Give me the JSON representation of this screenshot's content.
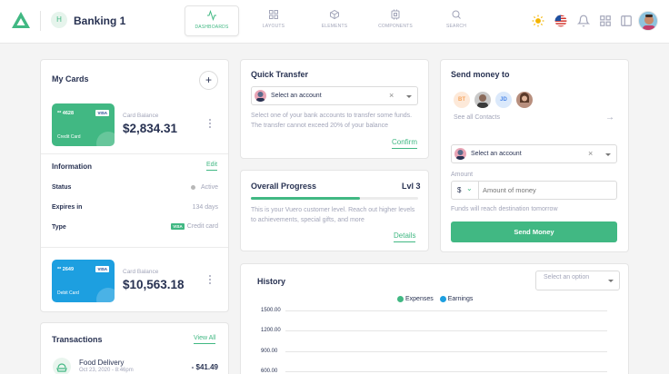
{
  "header": {
    "workspace_initial": "H",
    "workspace_title": "Banking 1",
    "nav": [
      {
        "label": "DASHBOARDS",
        "icon": "activity-icon",
        "active": true
      },
      {
        "label": "LAYOUTS",
        "icon": "grid-icon",
        "active": false
      },
      {
        "label": "ELEMENTS",
        "icon": "box-icon",
        "active": false
      },
      {
        "label": "COMPONENTS",
        "icon": "cpu-icon",
        "active": false
      },
      {
        "label": "SEARCH",
        "icon": "search-icon",
        "active": false
      }
    ],
    "right_icons": [
      "sun-icon",
      "us-flag-icon",
      "bell-icon",
      "apps-grid-icon",
      "sidebar-icon",
      "user-avatar"
    ]
  },
  "my_cards": {
    "title": "My Cards",
    "add_label": "+",
    "cards": [
      {
        "number": "** 4628",
        "brand": "VISA",
        "type": "Credit Card",
        "balance_label": "Card Balance",
        "balance": "$2,834.31",
        "color": "#41b883"
      },
      {
        "number": "** 2649",
        "brand": "VISA",
        "type": "Debit Card",
        "balance_label": "Card Balance",
        "balance": "$10,563.18",
        "color": "#1d9fe0"
      }
    ],
    "info_title": "Information",
    "edit_label": "Edit",
    "rows": [
      {
        "label": "Status",
        "value": "Active"
      },
      {
        "label": "Expires in",
        "value": "134 days"
      },
      {
        "label": "Type",
        "value": "Credit card",
        "badge": "VISA"
      }
    ]
  },
  "transactions": {
    "title": "Transactions",
    "view_all": "View All",
    "items": [
      {
        "name": "Food Delivery",
        "date": "Oct 23, 2020 - 8:46pm",
        "amount": "- $41.49"
      }
    ]
  },
  "quick_transfer": {
    "title": "Quick Transfer",
    "select_placeholder": "Select an account",
    "description": "Select one of your bank accounts to transfer some funds. The transfer cannot exceed 20% of your balance",
    "confirm_label": "Confirm"
  },
  "overall_progress": {
    "title": "Overall Progress",
    "level": "Lvl 3",
    "progress": 0.65,
    "description": "This is your Vuero customer level. Reach out higher levels to achievements, special gifts, and more",
    "details_label": "Details"
  },
  "send_money": {
    "title": "Send money to",
    "contacts": [
      {
        "initials": "BT",
        "bg": "#fde9d9",
        "fg": "#f5a45d"
      },
      {
        "initials": "",
        "bg": "#c9c9c9",
        "fg": "#283252"
      },
      {
        "initials": "JD",
        "bg": "#dbe9fb",
        "fg": "#4a86e8"
      },
      {
        "initials": "",
        "bg": "#b88f7e",
        "fg": "#283252"
      }
    ],
    "see_all": "See all Contacts",
    "select_placeholder": "Select an account",
    "amount_label": "Amount",
    "currency": "$",
    "amount_placeholder": "Amount of money",
    "note": "Funds will reach destination tomorrow",
    "button_label": "Send Money"
  },
  "history": {
    "title": "History",
    "select_placeholder": "Select an option",
    "legend": [
      {
        "name": "Expenses",
        "color": "#41b883"
      },
      {
        "name": "Earnings",
        "color": "#1d9fe0"
      }
    ],
    "y_ticks": [
      "1500.00",
      "1200.00",
      "900.00",
      "600.00"
    ]
  }
}
